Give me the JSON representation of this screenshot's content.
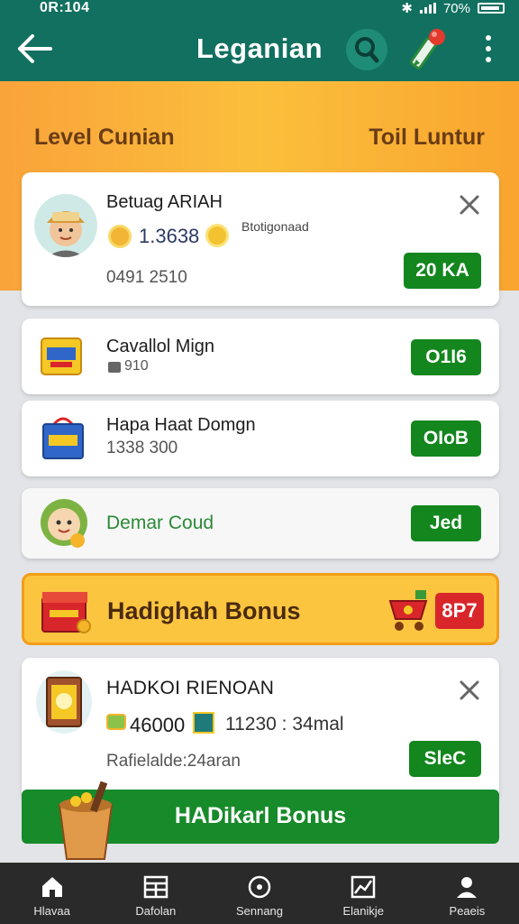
{
  "status": {
    "time": "0R:104",
    "battery": "70%"
  },
  "header": {
    "title": "Leganian"
  },
  "levels": {
    "left": "Level Cunian",
    "right": "Toil Luntur"
  },
  "profile": {
    "name": "Betuag ARIAH",
    "coins": "1.3638",
    "tag": "Btotigonaad",
    "number": "0491 2510",
    "button": "20 KA"
  },
  "rows": [
    {
      "title": "Cavallol Mign",
      "sub": "910",
      "button": "O1I6"
    },
    {
      "title": "Hapa Haat Domgn",
      "sub": "1338 300",
      "button": "OIoB"
    },
    {
      "title": "Demar Coud",
      "sub": "",
      "button": "Jed"
    }
  ],
  "bonus_banner": {
    "title": "Hadighah Bonus",
    "badge": "8P7"
  },
  "reward": {
    "title": "HADKOI RIENOAN",
    "value1": "46000",
    "value2": "11230 : 34mal",
    "sub": "Rafielalde:24aran",
    "button": "SleC"
  },
  "bonus_button": "HADikarl Bonus",
  "nav": [
    {
      "label": "Hlavaa",
      "icon": "home-icon"
    },
    {
      "label": "Dafolan",
      "icon": "grid-icon"
    },
    {
      "label": "Sennang",
      "icon": "compass-icon"
    },
    {
      "label": "Elanikje",
      "icon": "chart-icon"
    },
    {
      "label": "Peaeis",
      "icon": "person-icon"
    }
  ],
  "colors": {
    "header": "#117060",
    "accent_orange": "#f9a33a",
    "button_green": "#13861e",
    "badge_red": "#d8262b"
  }
}
